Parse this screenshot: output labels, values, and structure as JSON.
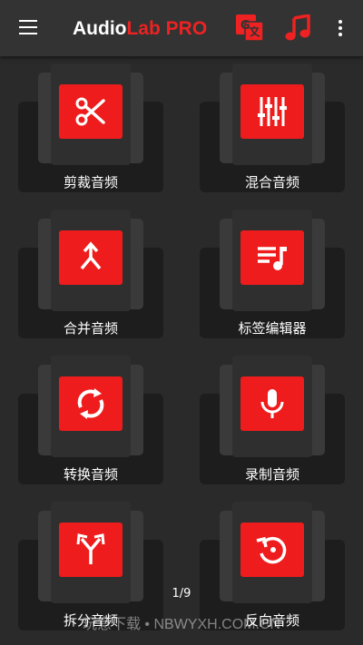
{
  "appbar": {
    "title_part1": "Audio",
    "title_part2": "Lab PRO",
    "menu_icon": "hamburger-menu-icon",
    "translate_icon": "translate-icon",
    "music_icon": "music-note-icon",
    "more_icon": "more-vertical-icon"
  },
  "colors": {
    "accent": "#ee1c1c",
    "appbar_bg": "#333333",
    "background": "#2a2a2a"
  },
  "features": [
    {
      "label": "剪裁音频",
      "icon": "scissors-icon"
    },
    {
      "label": "混合音频",
      "icon": "equalizer-icon"
    },
    {
      "label": "合并音频",
      "icon": "merge-icon"
    },
    {
      "label": "标签编辑器",
      "icon": "playlist-music-icon"
    },
    {
      "label": "转换音频",
      "icon": "sync-icon"
    },
    {
      "label": "录制音频",
      "icon": "microphone-icon"
    },
    {
      "label": "拆分音频",
      "icon": "split-icon"
    },
    {
      "label": "反向音频",
      "icon": "reverse-icon"
    }
  ],
  "pager": {
    "text": "1/9"
  },
  "watermark": {
    "text": "玩意下载 • NBWYXH.COM.CN"
  }
}
